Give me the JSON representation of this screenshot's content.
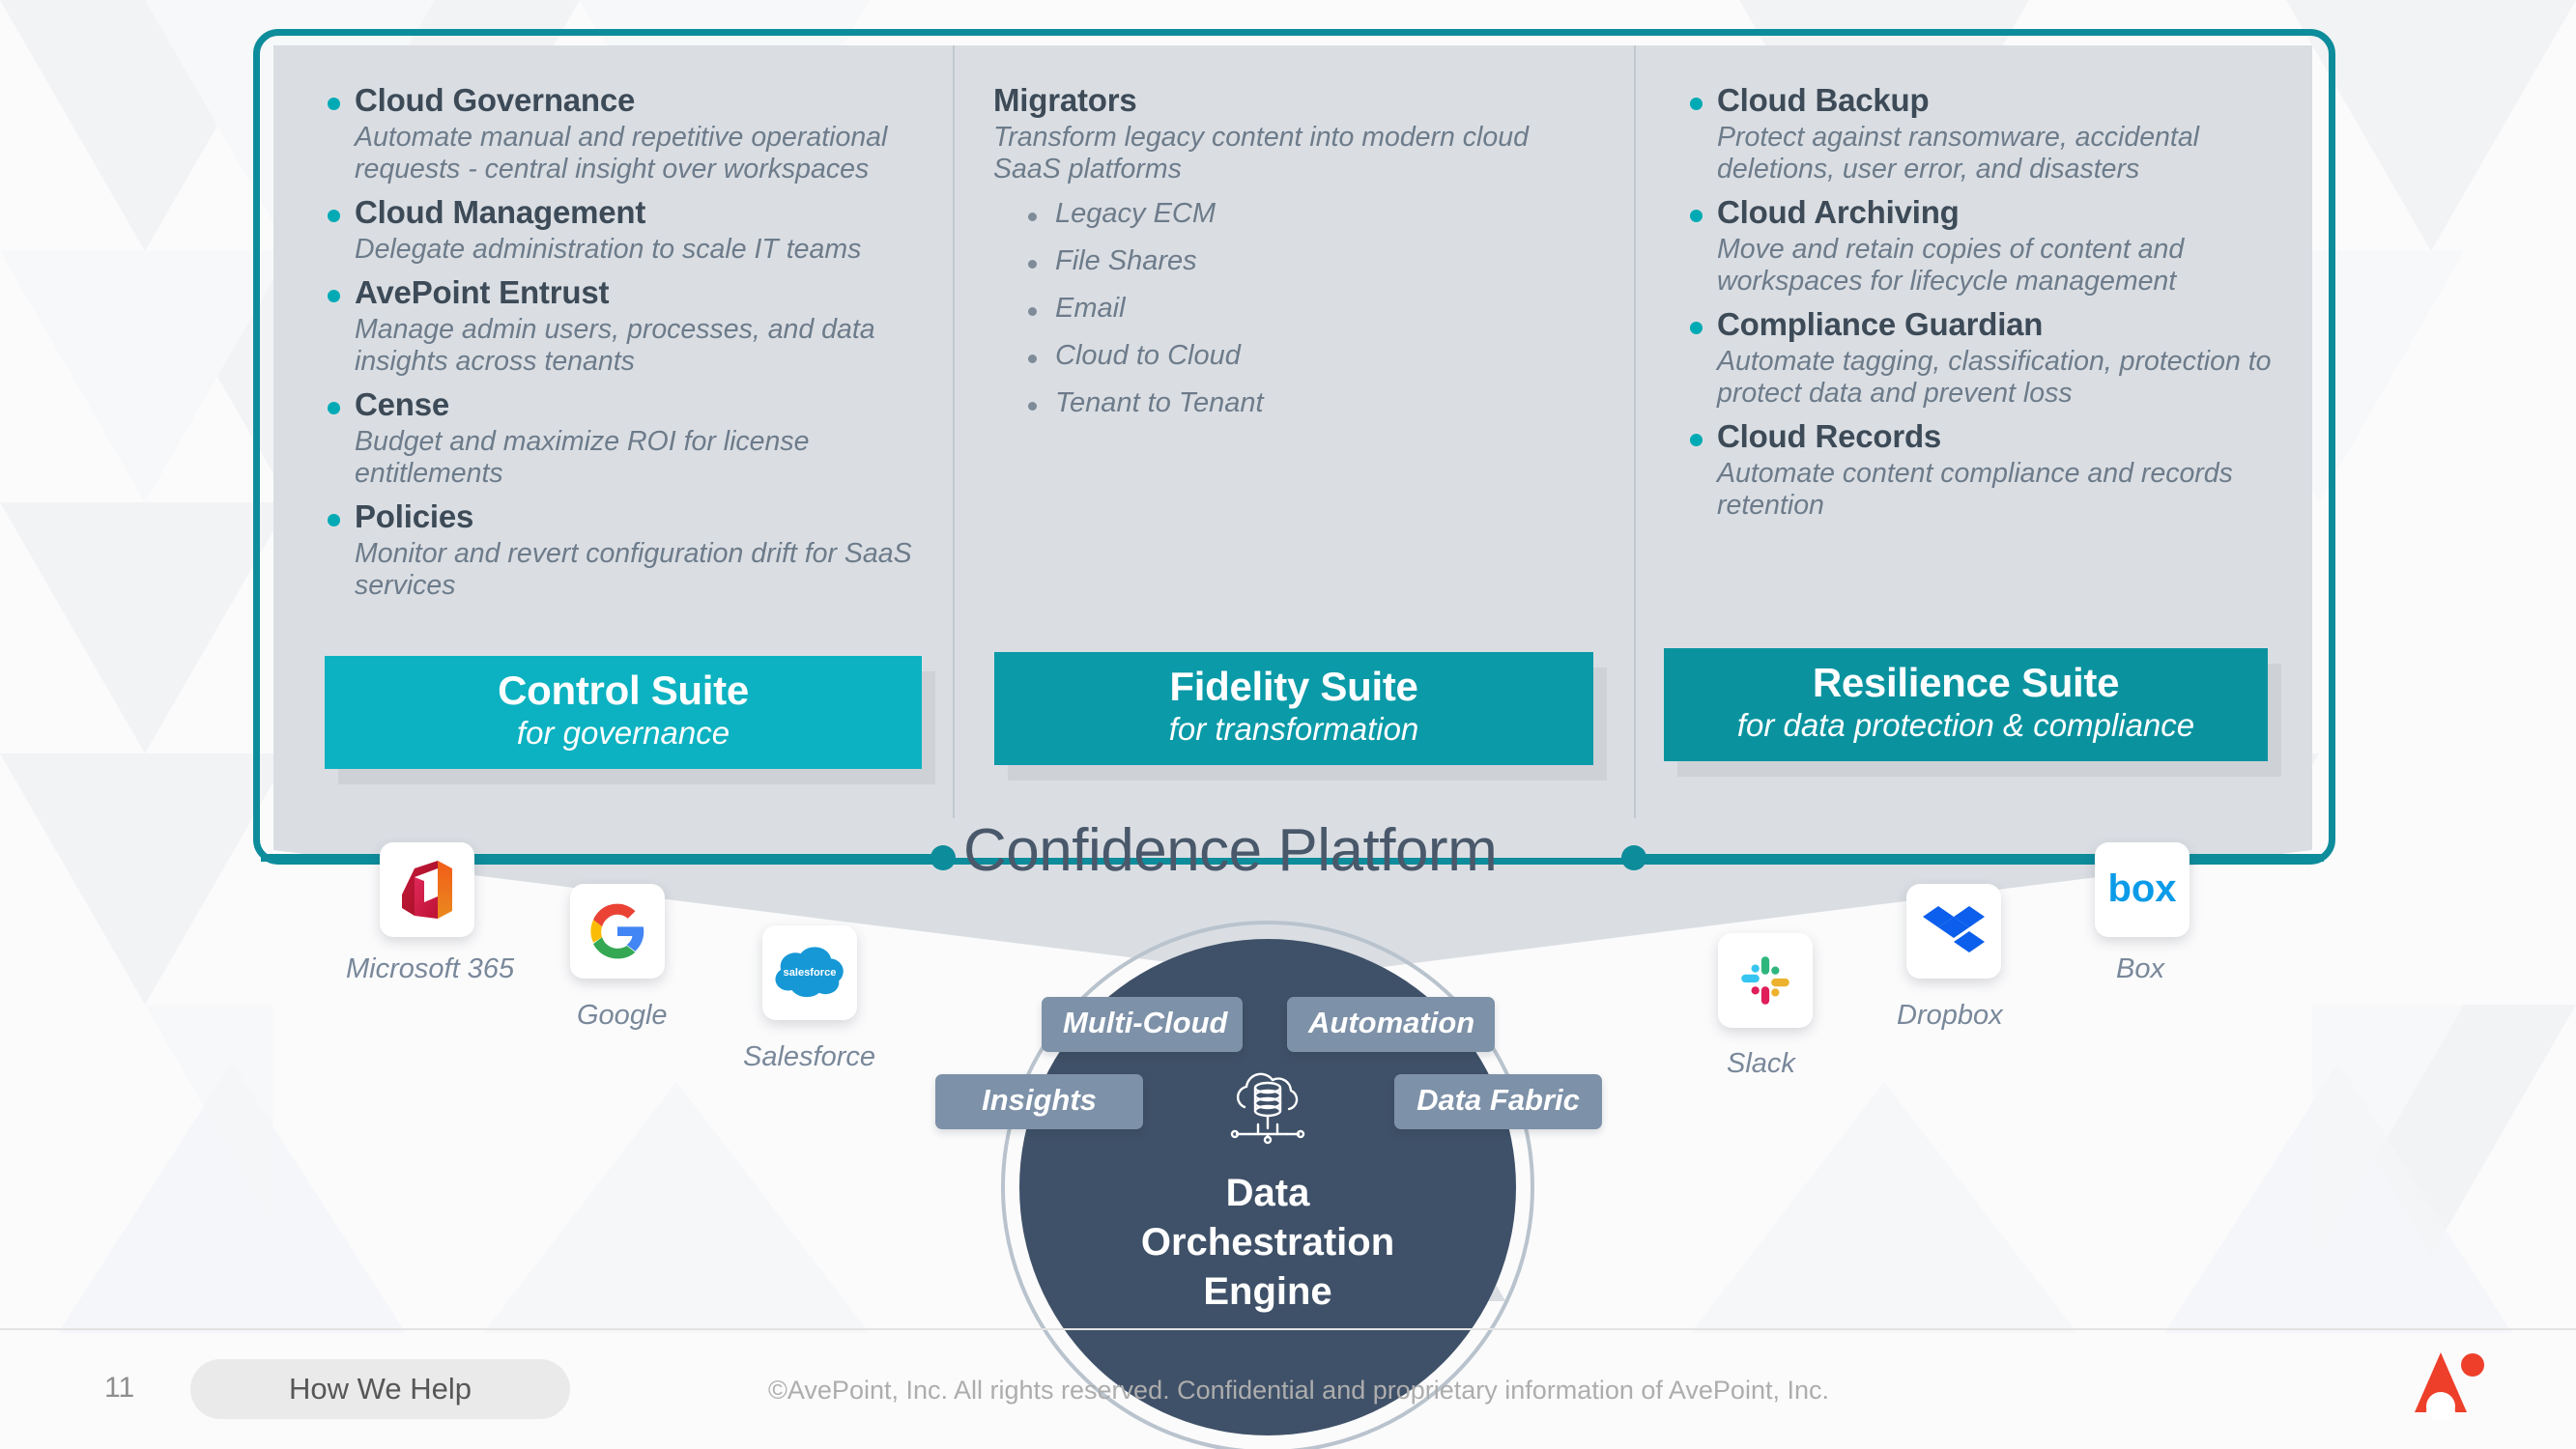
{
  "colors": {
    "teal_frame": "#0d8c9b",
    "bullet": "#00aab4",
    "control_suite_bg": "#0cb2c1",
    "fidelity_suite_bg": "#0a9aa8",
    "resilience_suite_bg": "#0a939f",
    "panel_grey": "#dadee3",
    "heading_navy": "#3d4a57",
    "body_grey": "#6d7b8a",
    "engine_navy": "#3f5168",
    "pill_grey": "#7d91a8",
    "avepoint_red": "#ee3f2a"
  },
  "columns": [
    {
      "id": "control",
      "features": [
        {
          "title": "Cloud Governance",
          "desc": "Automate manual and repetitive operational requests - central insight over workspaces"
        },
        {
          "title": "Cloud Management",
          "desc": "Delegate administration to scale IT teams"
        },
        {
          "title": "AvePoint Entrust",
          "desc": "Manage admin users, processes, and data insights across tenants"
        },
        {
          "title": "Cense",
          "desc": "Budget and maximize ROI for license entitlements"
        },
        {
          "title": "Policies",
          "desc": "Monitor and revert configuration drift for SaaS services"
        }
      ],
      "subitems": [],
      "banner": {
        "title": "Control Suite",
        "subtitle": "for governance"
      }
    },
    {
      "id": "fidelity",
      "features": [
        {
          "title": "Migrators",
          "desc": "Transform legacy content into modern cloud SaaS platforms",
          "bullet": false
        }
      ],
      "subitems": [
        "Legacy ECM",
        "File Shares",
        "Email",
        "Cloud to Cloud",
        "Tenant to Tenant"
      ],
      "banner": {
        "title": "Fidelity Suite",
        "subtitle": "for transformation"
      }
    },
    {
      "id": "resilience",
      "features": [
        {
          "title": "Cloud Backup",
          "desc": "Protect against ransomware, accidental deletions, user error, and disasters"
        },
        {
          "title": "Cloud Archiving",
          "desc": "Move and retain copies of content and workspaces for lifecycle management"
        },
        {
          "title": "Compliance Guardian",
          "desc": "Automate tagging, classification, protection to protect data and prevent loss"
        },
        {
          "title": "Cloud Records",
          "desc": "Automate content compliance and records retention"
        }
      ],
      "subitems": [],
      "banner": {
        "title": "Resilience Suite",
        "subtitle": "for data protection & compliance"
      }
    }
  ],
  "platform": {
    "title": "Confidence Platform"
  },
  "integrations": [
    {
      "name": "Microsoft 365",
      "icon": "microsoft-365-icon"
    },
    {
      "name": "Google",
      "icon": "google-icon"
    },
    {
      "name": "Salesforce",
      "icon": "salesforce-icon"
    },
    {
      "name": "Slack",
      "icon": "slack-icon"
    },
    {
      "name": "Dropbox",
      "icon": "dropbox-icon"
    },
    {
      "name": "Box",
      "icon": "box-icon"
    }
  ],
  "engine": {
    "line1": "Data",
    "line2": "Orchestration",
    "line3": "Engine",
    "icon": "cloud-database-network-icon",
    "pills": [
      "Multi-Cloud",
      "Automation",
      "Insights",
      "Data Fabric"
    ]
  },
  "footer": {
    "page_number": "11",
    "section_label": "How We Help",
    "copyright": "©AvePoint, Inc. All rights reserved. Confidential and proprietary information of AvePoint, Inc.",
    "logo": "avepoint-logo"
  }
}
